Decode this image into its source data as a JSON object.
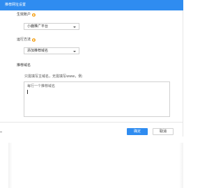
{
  "dialog": {
    "title": "推荐网址设置",
    "fields": {
      "account": {
        "label": "生效账户",
        "value": "小鹿推广平台"
      },
      "method": {
        "label": "运行方法",
        "value": "添加推荐域名"
      },
      "domains": {
        "label": "推荐域名",
        "hint": "只需填写主域名，无需填写www，例:",
        "placeholder": "每行一个推荐域名"
      }
    },
    "buttons": {
      "ok": "确定",
      "cancel": "取消"
    }
  },
  "colors": {
    "primary": "#2f8cf0",
    "info": "#f5a623"
  },
  "icons": {
    "info": "info-icon",
    "caret": "chevron-down-icon"
  }
}
